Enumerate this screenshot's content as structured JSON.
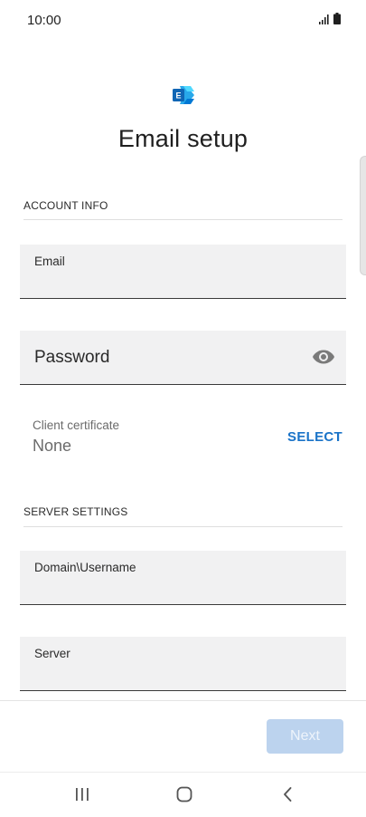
{
  "status_bar": {
    "time": "10:00",
    "signal_icon": "signal-icon",
    "battery_icon": "battery-icon"
  },
  "header": {
    "logo_icon": "exchange-logo-icon",
    "title": "Email setup"
  },
  "account_info": {
    "section_title": "ACCOUNT INFO",
    "email_label": "Email",
    "password_label": "Password",
    "password_toggle_icon": "eye-icon",
    "client_certificate": {
      "label": "Client certificate",
      "value": "None",
      "action": "SELECT"
    }
  },
  "server_settings": {
    "section_title": "SERVER SETTINGS",
    "domain_username_label": "Domain\\Username",
    "server_label": "Server"
  },
  "footer": {
    "next_label": "Next"
  },
  "navigation": {
    "recents_icon": "recents-icon",
    "home_icon": "home-icon",
    "back_icon": "back-icon"
  },
  "colors": {
    "accent": "#1a73c8",
    "disabled_button": "#bcd3ee",
    "field_background": "#f1f1f2"
  }
}
